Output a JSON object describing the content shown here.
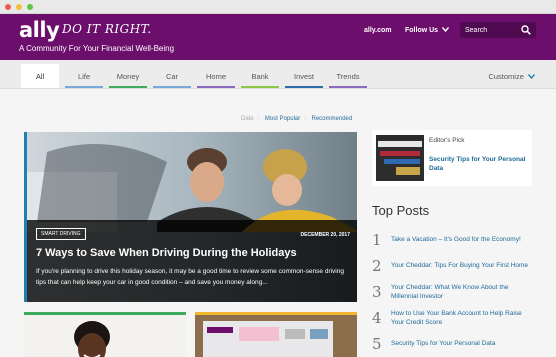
{
  "brand": {
    "logo": "ally",
    "slogan": "DO IT RIGHT.",
    "tagline": "A Community For Your Financial Well-Being",
    "purple": "#6b0e6c"
  },
  "header": {
    "links": [
      "ally.com",
      "Follow Us"
    ],
    "search_placeholder": "Search"
  },
  "tabs": [
    {
      "label": "All",
      "color": "#ffffff"
    },
    {
      "label": "Life",
      "color": "#78a8d8"
    },
    {
      "label": "Money",
      "color": "#3cab5e"
    },
    {
      "label": "Car",
      "color": "#78a8d8"
    },
    {
      "label": "Home",
      "color": "#8a6ac0"
    },
    {
      "label": "Bank",
      "color": "#8ec64a"
    },
    {
      "label": "Invest",
      "color": "#2b6da8"
    },
    {
      "label": "Trends",
      "color": "#8a6ac0"
    }
  ],
  "customize_label": "Customize",
  "sort": [
    "Date",
    "Most Popular",
    "Recommended"
  ],
  "hero": {
    "category": "SMART DRIVING",
    "date": "DECEMBER 20, 2017",
    "title": "7 Ways to Save When Driving During the Holidays",
    "description": "If you're planning to drive this holiday season, it may be a good time to review some common-sense driving tips that can help keep your car in good condition – and save you money along..."
  },
  "editors_pick": {
    "label": "Editor's Pick",
    "title": "Security Tips for Your Personal Data"
  },
  "top_posts": {
    "title": "Top Posts",
    "items": [
      {
        "num": "1",
        "text": "Take a Vacation – It's Good for the Economy!"
      },
      {
        "num": "2",
        "text": "Your Cheddar: Tips For Buying Your First Home"
      },
      {
        "num": "3",
        "text": "Your Cheddar: What We Know About the Millennial Investor"
      },
      {
        "num": "4",
        "text": "How to Use Your Bank Account to Help Raise Your Credit Score"
      },
      {
        "num": "5",
        "text": "Security Tips for Your Personal Data"
      }
    ]
  }
}
